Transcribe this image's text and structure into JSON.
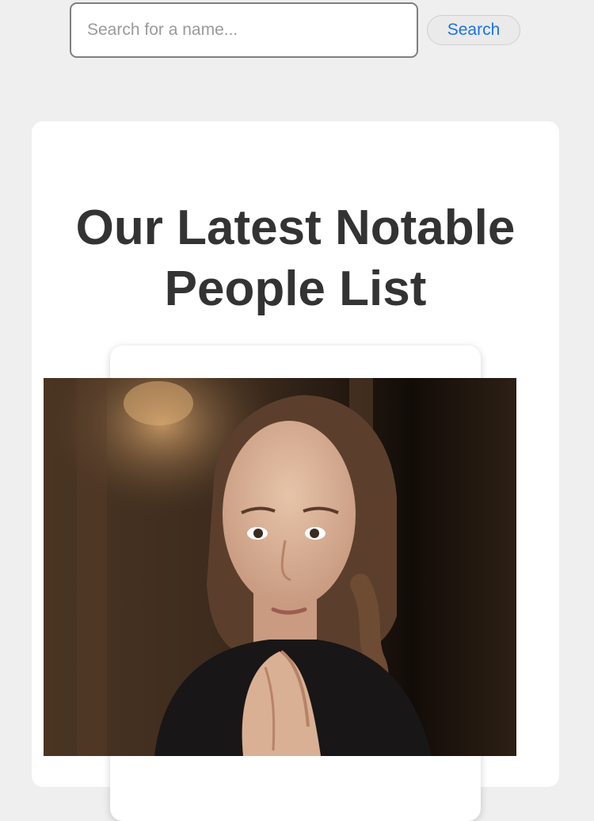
{
  "search": {
    "placeholder": "Search for a name...",
    "value": "",
    "button_label": "Search"
  },
  "main": {
    "title": "Our Latest Notable People List"
  },
  "colors": {
    "page_background": "#efefef",
    "card_background": "#ffffff",
    "title_text": "#333333",
    "search_button_text": "#1a73e8"
  },
  "person_card": {
    "image_icon": "person-portrait"
  }
}
